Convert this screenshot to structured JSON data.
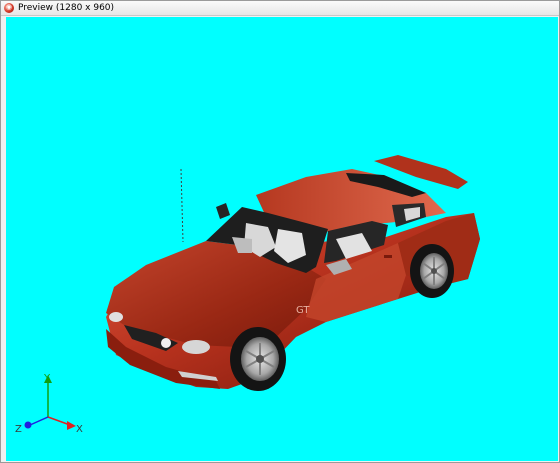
{
  "window": {
    "title": "Preview (1280 x 960)",
    "icon": "app-icon"
  },
  "viewport": {
    "background": "#00ffff",
    "model_color": "#c0392b",
    "badge": "GT"
  },
  "axes": {
    "x_label": "X",
    "y_label": "Y",
    "z_label": "Z",
    "x_color": "#e02020",
    "y_color": "#10a010",
    "z_color": "#2020e0"
  }
}
